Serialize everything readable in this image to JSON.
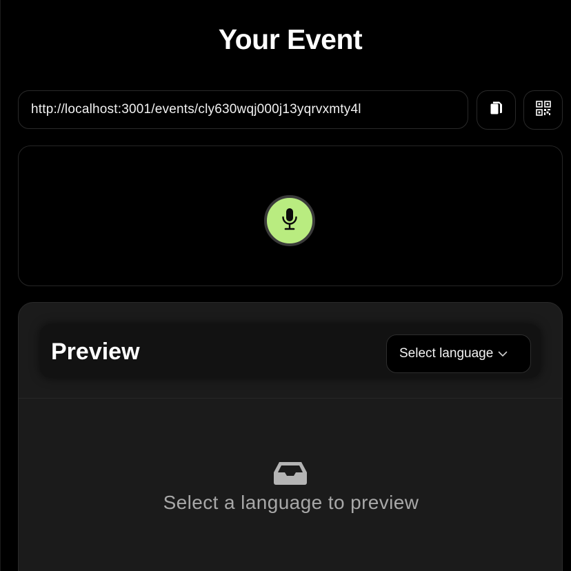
{
  "header": {
    "title": "Your Event"
  },
  "share": {
    "url": "http://localhost:3001/events/cly630wqj000j13yqrvxmty4l",
    "copy_icon": "copy-icon",
    "qr_icon": "qr-code-icon"
  },
  "recorder": {
    "mic_icon": "microphone-icon",
    "accent_color": "#b9ec80"
  },
  "preview": {
    "title": "Preview",
    "language_select": {
      "selected": "Select language"
    },
    "empty_state": {
      "icon": "inbox-icon",
      "message": "Select a language to preview"
    }
  }
}
